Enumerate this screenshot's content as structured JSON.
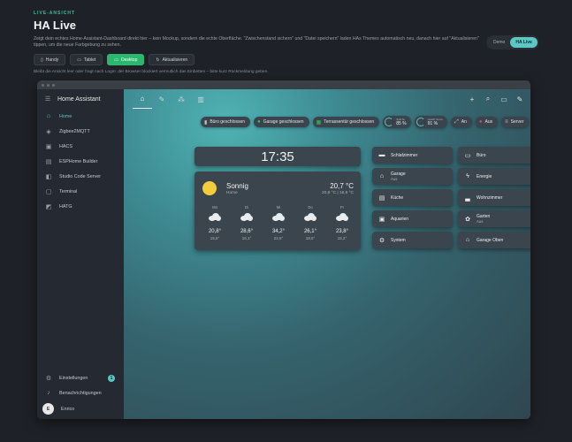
{
  "header": {
    "kicker": "LIVE-ANSICHT",
    "title": "HA Live",
    "description": "Zeigt dein echtes Home-Assistant-Dashboard direkt hier – kein Mockup, sondern die echte Oberfläche. \"Zwischenstand sichern\" und \"Datei speichern\" laden HAs Themes automatisch neu, danach hier auf \"Aktualisieren\" tippen, um die neue Farbgebung zu sehen.",
    "modes": [
      "Demo",
      "HA Live"
    ],
    "active_mode": "HA Live"
  },
  "toolbar": {
    "handy": "Handy",
    "tablet": "Tablet",
    "desktop": "Desktop",
    "refresh": "Aktualisieren"
  },
  "hint": "Bleibt die Ansicht leer oder fragt nach Login: der Browser blockiert vermutlich das Einbetten – bitte kurz Rückmeldung geben.",
  "sidebar": {
    "app_title": "Home Assistant",
    "items": [
      {
        "label": "Home",
        "icon": "home-icon",
        "active": true
      },
      {
        "label": "Zigbee2MQTT",
        "icon": "zigbee-icon"
      },
      {
        "label": "HACS",
        "icon": "hacs-icon"
      },
      {
        "label": "ESPHome Builder",
        "icon": "esphome-icon"
      },
      {
        "label": "Studio Code Server",
        "icon": "vscode-icon"
      },
      {
        "label": "Terminal",
        "icon": "terminal-icon"
      },
      {
        "label": "HATG",
        "icon": "hatg-icon"
      }
    ],
    "settings": "Einstellungen",
    "settings_badge": "1",
    "notifications": "Benachrichtigungen",
    "user": "Enrico",
    "user_initial": "E"
  },
  "chips": {
    "buero": "Büro geschlossen",
    "garage": "Garage geschlossen",
    "terrasse": "Terrassentür geschlossen",
    "gauge1_label": "Spliche",
    "gauge1_value": "85 %",
    "gauge1_level": 0.85,
    "gauge2_label": "Health Score",
    "gauge2_value": "91 %",
    "gauge2_level": 0.91,
    "an": "An",
    "aus": "Aus",
    "server": "Server"
  },
  "clock": "17:35",
  "weather": {
    "condition": "Sonnig",
    "location": "Home",
    "temp": "20,7 °C",
    "range": "20,8 °C | 16,8 °C",
    "days": [
      {
        "name": "Mo",
        "hi": "20,8°",
        "lo": "16,8°"
      },
      {
        "name": "Di",
        "hi": "28,6°",
        "lo": "16,1°"
      },
      {
        "name": "Mi",
        "hi": "34,2°",
        "lo": "22,6°"
      },
      {
        "name": "Do",
        "hi": "26,1°",
        "lo": "18,8°"
      },
      {
        "name": "Fr",
        "hi": "23,8°",
        "lo": "15,2°"
      }
    ]
  },
  "rooms": [
    {
      "label": "Schlafzimmer",
      "sub": "",
      "icon": "bed-icon"
    },
    {
      "label": "Büro",
      "sub": "",
      "icon": "office-icon"
    },
    {
      "label": "Garage",
      "sub": "Aus",
      "icon": "garage-icon"
    },
    {
      "label": "Energie",
      "sub": "",
      "icon": "lightning-icon"
    },
    {
      "label": "Küche",
      "sub": "",
      "icon": "kitchen-icon"
    },
    {
      "label": "Wohnzimmer",
      "sub": "",
      "icon": "sofa-icon"
    },
    {
      "label": "Aquarien",
      "sub": "",
      "icon": "aquarium-icon"
    },
    {
      "label": "Garten",
      "sub": "Aus",
      "icon": "flower-icon"
    },
    {
      "label": "System",
      "sub": "",
      "icon": "gear-icon"
    },
    {
      "label": "Garage Oben",
      "sub": "",
      "icon": "garage-icon"
    }
  ]
}
